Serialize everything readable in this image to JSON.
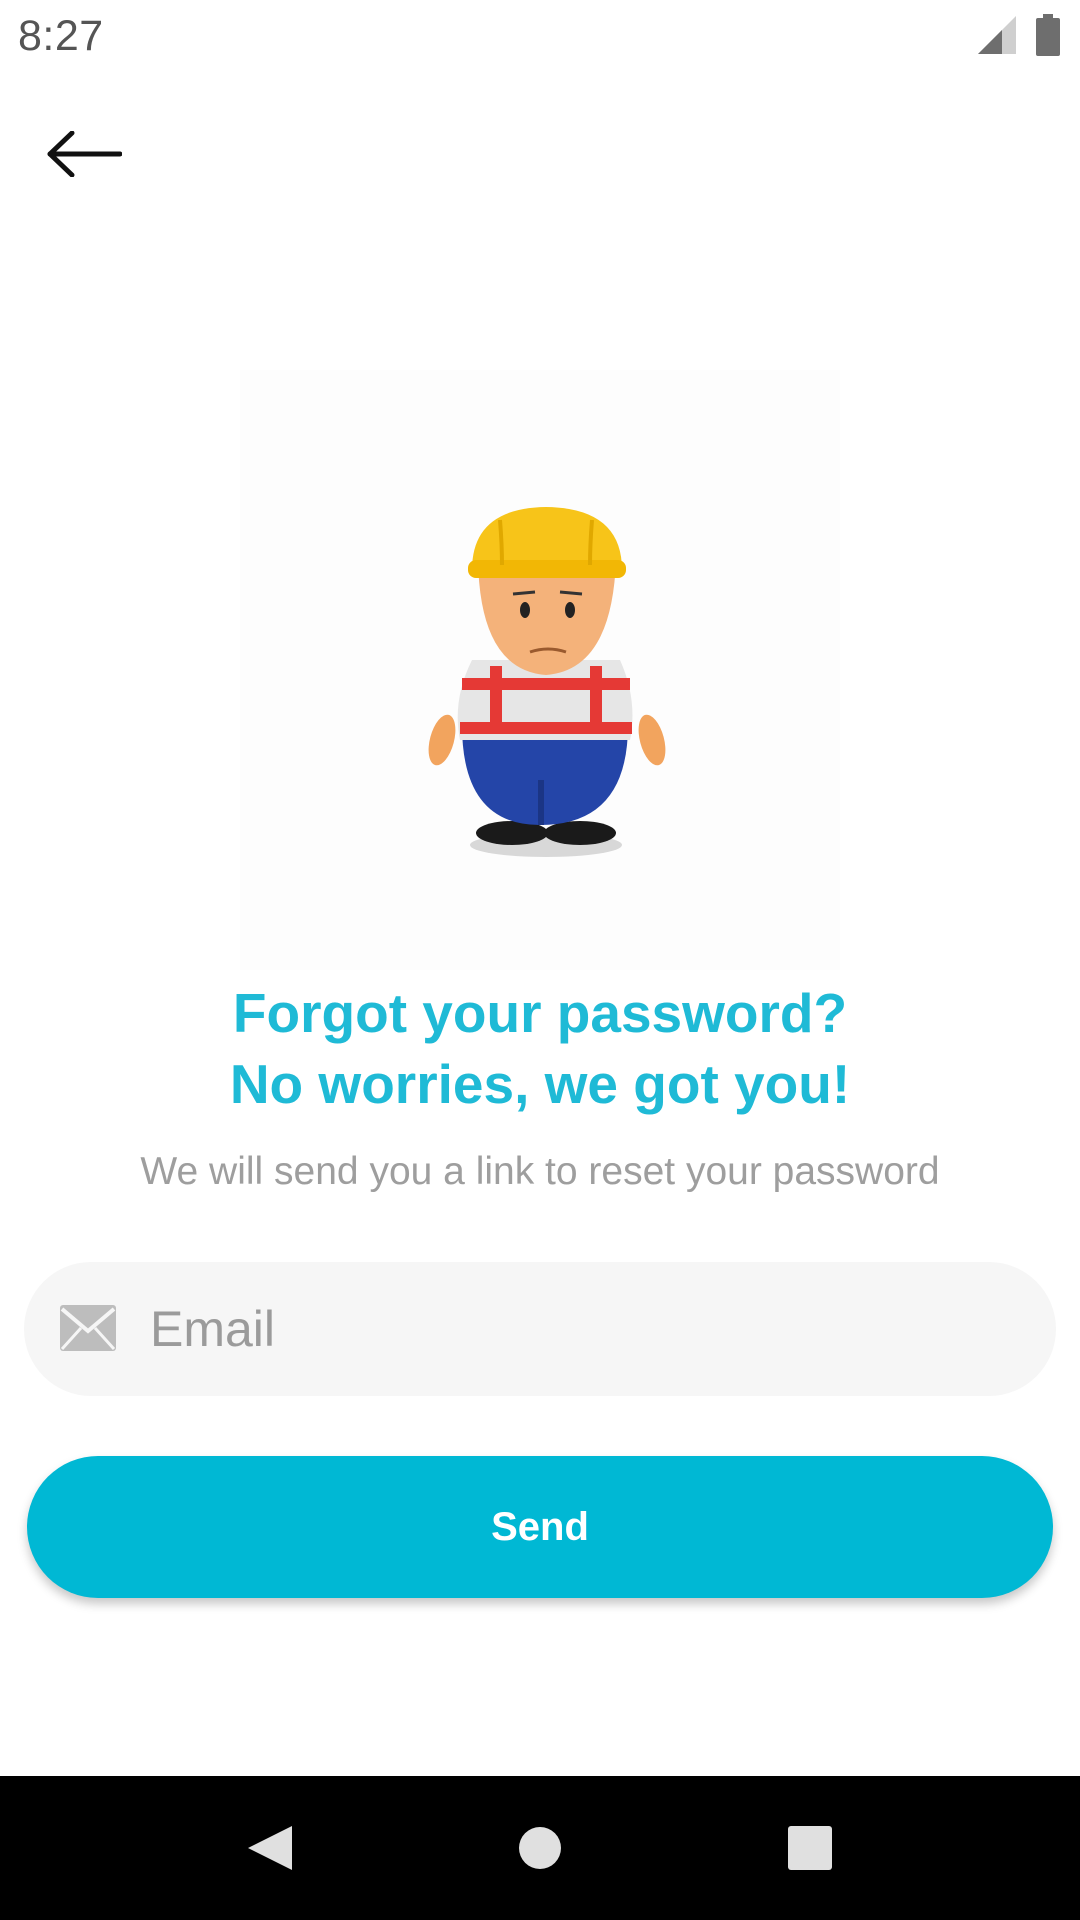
{
  "status_bar": {
    "time": "8:27",
    "icons": [
      "cellular-signal-icon",
      "battery-icon"
    ]
  },
  "toolbar": {
    "back_icon": "arrow-left-icon"
  },
  "hero": {
    "illustration": "construction-worker-mascot"
  },
  "headline": {
    "line1": "Forgot your password?",
    "line2": "No worries, we got you!"
  },
  "subtitle": "We will send you a link to reset your password",
  "email_field": {
    "icon": "envelope-icon",
    "placeholder": "Email",
    "value": ""
  },
  "send_button": {
    "label": "Send"
  },
  "nav_bar": {
    "items": [
      "back-triangle-icon",
      "home-circle-icon",
      "recents-square-icon"
    ]
  },
  "colors": {
    "accent": "#1fbad6",
    "button": "#00b8d4",
    "subtitle_text": "#9e9e9e",
    "field_bg": "#f6f6f6",
    "nav_bg": "#000000"
  }
}
